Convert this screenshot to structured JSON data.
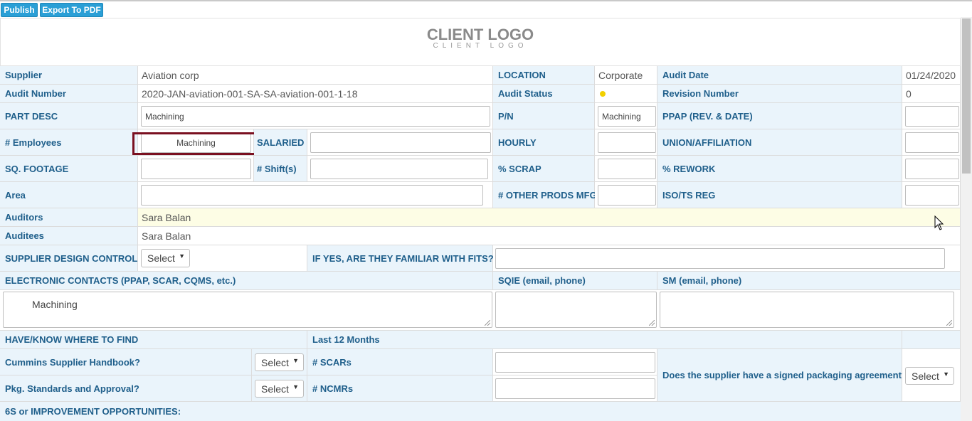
{
  "toolbar": {
    "publish_label": "Publish",
    "export_label": "Export To PDF"
  },
  "logo": {
    "main": "CLIENT LOGO",
    "sub": "CLIENT LOGO"
  },
  "colors": {
    "accent": "#2a9fd6",
    "label": "#1f5f8b",
    "status_dot": "#f2d000",
    "highlight_border": "#7a1020"
  },
  "form": {
    "supplier_label": "Supplier",
    "supplier_value": "Aviation corp",
    "location_label": "LOCATION",
    "location_value": "Corporate",
    "audit_date_label": "Audit Date",
    "audit_date_value": "01/24/2020",
    "audit_number_label": "Audit Number",
    "audit_number_value": "2020-JAN-aviation-001-SA-SA-aviation-001-1-18",
    "audit_status_label": "Audit Status",
    "revision_label": "Revision Number",
    "revision_value": "0",
    "part_desc_label": "PART DESC",
    "part_desc_value": "Machining",
    "pn_label": "P/N",
    "pn_value": "Machining",
    "ppap_label": "PPAP (REV. & DATE)",
    "ppap_value": "",
    "employees_label": "# Employees",
    "employees_value": "Machining",
    "salaried_label": "SALARIED",
    "salaried_value": "",
    "hourly_label": "HOURLY",
    "hourly_value": "",
    "union_label": "UNION/AFFILIATION",
    "union_value": "",
    "sqft_label": "SQ. FOOTAGE",
    "sqft_value": "",
    "shifts_label": "# Shift(s)",
    "shifts_value": "",
    "scrap_label": "% SCRAP",
    "scrap_value": "",
    "rework_label": "% REWORK",
    "rework_value": "",
    "area_label": "Area",
    "area_value": "",
    "other_prods_label": "# OTHER PRODS MFG",
    "other_prods_value": "",
    "iso_label": "ISO/TS REG",
    "iso_value": "",
    "auditors_label": "Auditors",
    "auditors_value": "Sara Balan",
    "auditees_label": "Auditees",
    "auditees_value": "Sara Balan",
    "design_control_label": "SUPPLIER DESIGN CONTROL?",
    "design_control_select": "Select",
    "fits_label": "IF YES, ARE THEY FAMILIAR WITH FITS?",
    "fits_value": "",
    "econtacts_label": "ELECTRONIC CONTACTS (PPAP, SCAR, CQMS, etc.)",
    "econtacts_value": "Machining",
    "sqie_label": "SQIE (email, phone)",
    "sqie_value": "",
    "sm_label": "SM (email, phone)",
    "sm_value": "",
    "have_know_label": "HAVE/KNOW WHERE TO FIND",
    "last12_label": "Last 12 Months",
    "handbook_label": "Cummins Supplier Handbook?",
    "handbook_select": "Select",
    "scars_label": "# SCARs",
    "scars_value": "",
    "packaging_label": "Does the supplier have a signed packaging agreement?",
    "packaging_select": "Select",
    "pkg_label": "Pkg. Standards and Approval?",
    "pkg_select": "Select",
    "ncmrs_label": "# NCMRs",
    "ncmrs_value": "",
    "improvement_label": "6S or IMPROVEMENT OPPORTUNITIES:"
  }
}
